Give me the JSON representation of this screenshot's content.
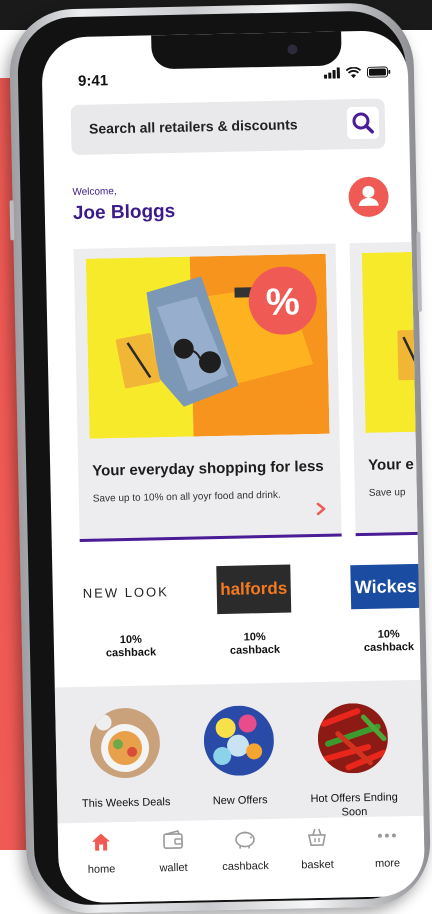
{
  "status_bar": {
    "time": "9:41"
  },
  "search": {
    "placeholder": "Search all retailers & discounts"
  },
  "user": {
    "welcome": "Welcome,",
    "name": "Joe Bloggs"
  },
  "carousel": {
    "cards": [
      {
        "title": "Your everyday shopping for less",
        "subtitle": "Save up to 10% on all yoyr food and drink.",
        "badge": "%"
      },
      {
        "title": "Your e",
        "subtitle": "Save up"
      }
    ]
  },
  "brands": [
    {
      "name": "NEW LOOK",
      "cashback_value": "10%",
      "cashback_label": "cashback"
    },
    {
      "name": "halfords",
      "cashback_value": "10%",
      "cashback_label": "cashback"
    },
    {
      "name": "Wickes",
      "cashback_value": "10%",
      "cashback_label": "cashback"
    }
  ],
  "offers": [
    {
      "label": "This Weeks Deals"
    },
    {
      "label": "New Offers"
    },
    {
      "label": "Hot Offers Ending Soon"
    }
  ],
  "tabs": [
    {
      "label": "home",
      "icon": "home-icon",
      "active": true
    },
    {
      "label": "wallet",
      "icon": "wallet-icon"
    },
    {
      "label": "cashback",
      "icon": "piggy-bank-icon"
    },
    {
      "label": "basket",
      "icon": "basket-icon"
    },
    {
      "label": "more",
      "icon": "more-icon"
    }
  ],
  "colors": {
    "accent": "#f05a55",
    "brand": "#3c1a8a",
    "halfords": "#f47a20",
    "wickes": "#1a4ca1"
  }
}
